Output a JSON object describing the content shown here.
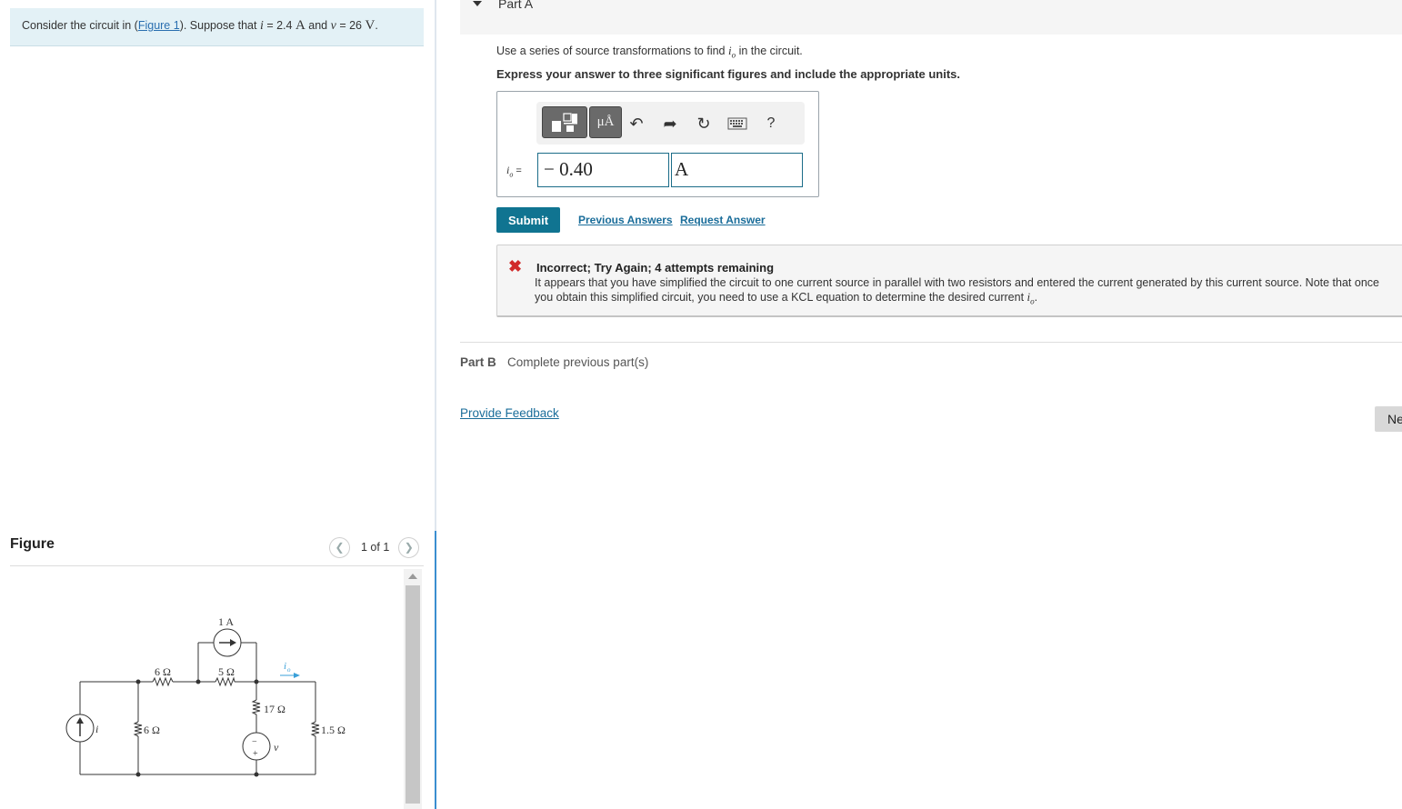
{
  "problem": {
    "prefix": "Consider the circuit in (",
    "figure_link": "Figure 1",
    "mid": "). Suppose that",
    "var_i": "i",
    "eq_i": " = 2.4",
    "unit_i": "A",
    "and": " and",
    "var_v": "v",
    "eq_v": " = 26",
    "unit_v": "V",
    "end": "."
  },
  "figure": {
    "title": "Figure",
    "pager": "1 of 1",
    "labels": {
      "source_1a": "1 A",
      "r6_top": "6 Ω",
      "r5": "5 Ω",
      "io": "i",
      "io_sub": "o",
      "r17": "17 Ω",
      "r6_left": "6 Ω",
      "r15": "1.5 Ω",
      "i": "i",
      "v": "v",
      "minus": "−",
      "plus": "+"
    }
  },
  "part_a": {
    "title": "Part A",
    "instruction_pre": "Use a series of source transformations to find",
    "instruction_var": "i",
    "instruction_sub": "o",
    "instruction_post": " in the circuit.",
    "instruction_bold": "Express your answer to three significant figures and include the appropriate units.",
    "toolbar": {
      "units_label": "μÅ",
      "help_label": "?"
    },
    "answer_var": "i",
    "answer_sub": "o",
    "answer_eq": " =",
    "answer_value": "− 0.40",
    "answer_unit": "A",
    "submit_label": "Submit",
    "previous_answers_label": "Previous Answers",
    "request_answer_label": "Request Answer",
    "feedback": {
      "title": "Incorrect; Try Again; 4 attempts remaining",
      "line1": "It appears that you have simplified the circuit to one current source in parallel with two resistors and entered the current generated by this current source. Note that once",
      "line2_pre": "you obtain this simplified circuit, you need to use a KCL equation to determine the desired current",
      "line2_var": "i",
      "line2_sub": "o",
      "line2_end": "."
    }
  },
  "part_b": {
    "label": "Part B",
    "status": "Complete previous part(s)"
  },
  "footer": {
    "provide_feedback_label": "Provide Feedback",
    "next_label": "Ne"
  },
  "colors": {
    "problem_bg": "#e3f1f6",
    "submit_bg": "#107491",
    "link": "#1a6d9a",
    "error": "#d12a2a"
  }
}
